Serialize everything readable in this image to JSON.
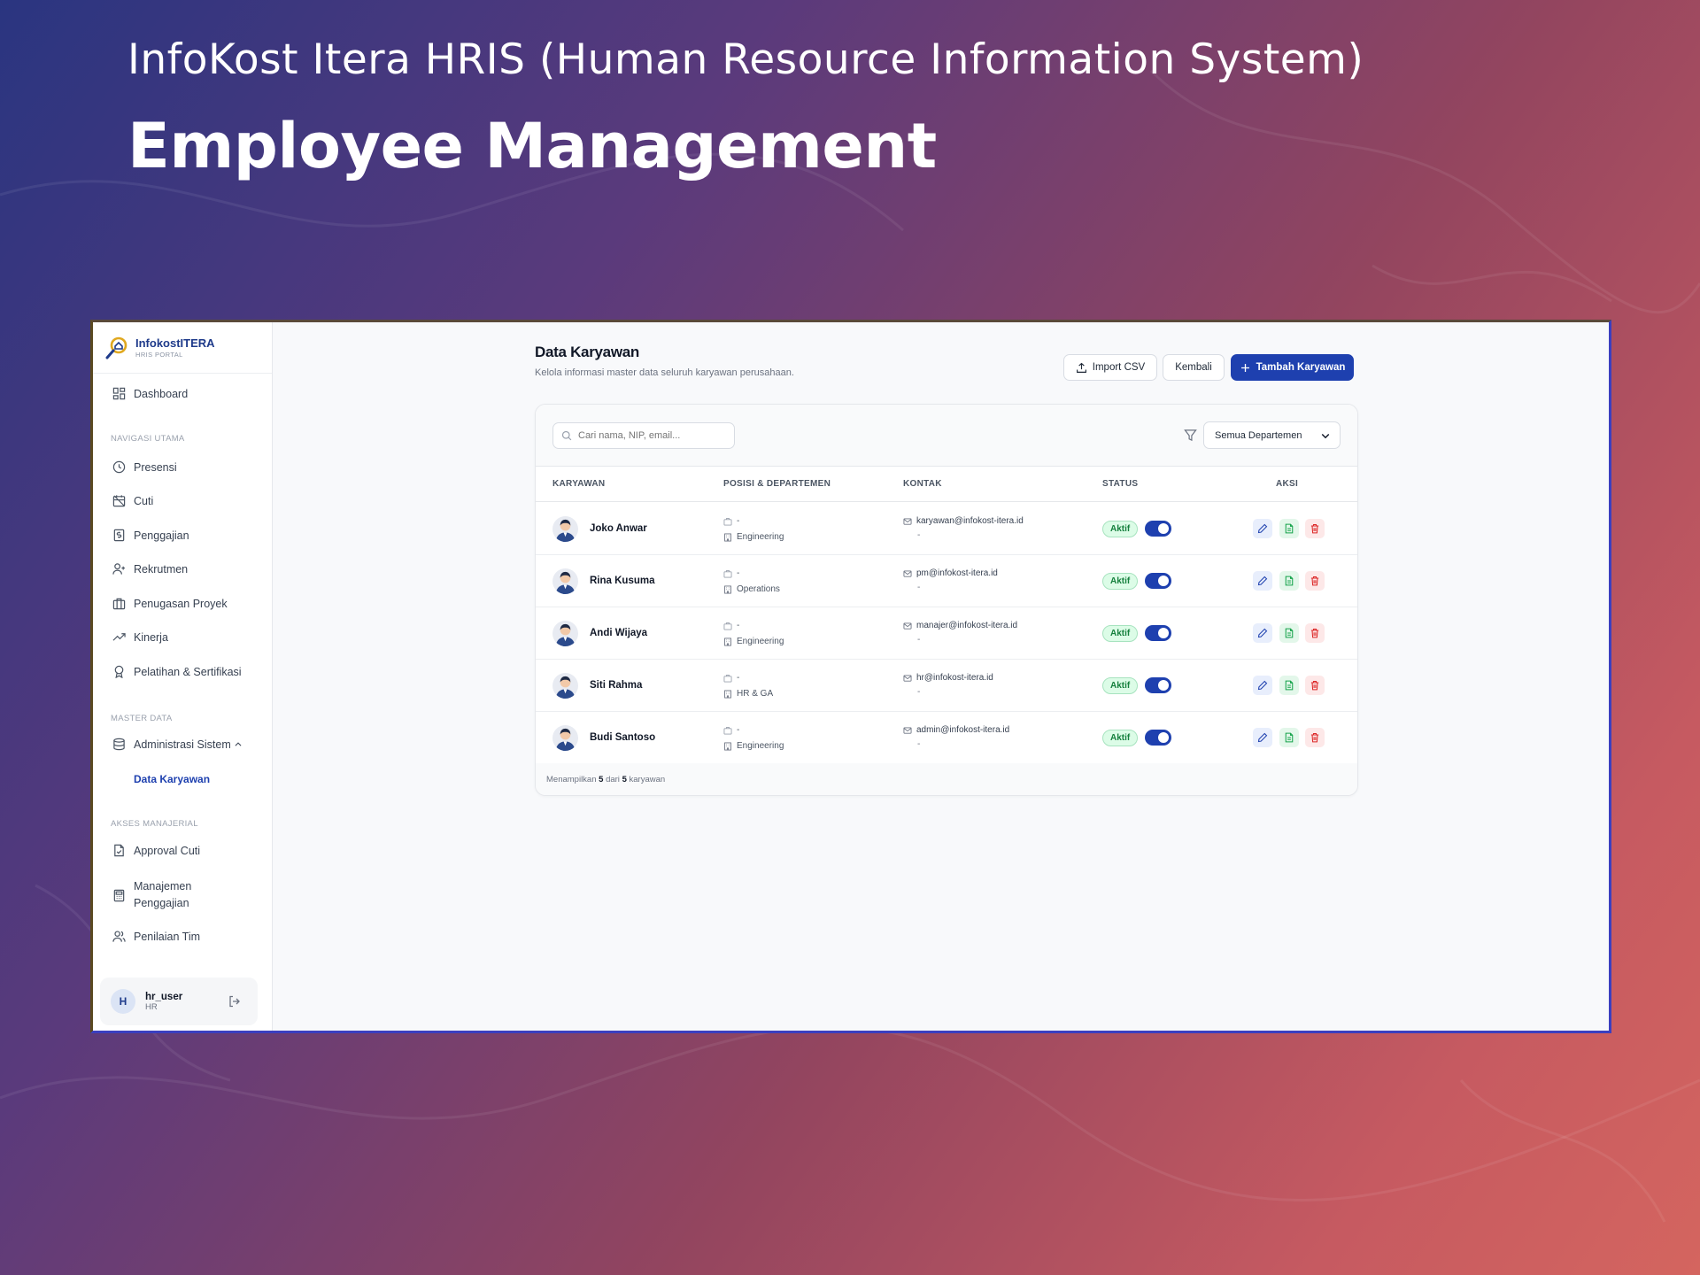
{
  "hero": {
    "subtitle": "InfoKost Itera HRIS (Human Resource Information System)",
    "title": "Employee Management"
  },
  "brand": {
    "name": "InfokostITERA",
    "sub": "HRIS PORTAL"
  },
  "sidebar": {
    "dashboard": "Dashboard",
    "section_main": "NAVIGASI UTAMA",
    "main_items": [
      {
        "label": "Presensi",
        "icon": "clock-icon"
      },
      {
        "label": "Cuti",
        "icon": "calendar-off-icon"
      },
      {
        "label": "Penggajian",
        "icon": "payroll-icon"
      },
      {
        "label": "Rekrutmen",
        "icon": "user-plus-icon"
      },
      {
        "label": "Penugasan Proyek",
        "icon": "briefcase-icon"
      },
      {
        "label": "Kinerja",
        "icon": "trending-up-icon"
      },
      {
        "label": "Pelatihan & Sertifikasi",
        "icon": "award-icon"
      }
    ],
    "section_master": "MASTER DATA",
    "admin": "Administrasi Sistem",
    "admin_sub": "Data Karyawan",
    "section_managerial": "AKSES MANAJERIAL",
    "managerial_items": [
      {
        "label": "Approval Cuti",
        "icon": "file-check-icon"
      },
      {
        "label": "Manajemen",
        "label2": "Penggajian",
        "icon": "calculator-icon"
      },
      {
        "label": "Penilaian Tim",
        "icon": "users-icon"
      }
    ]
  },
  "user": {
    "initial": "H",
    "name": "hr_user",
    "role": "HR"
  },
  "page": {
    "title": "Data Karyawan",
    "description": "Kelola informasi master data seluruh karyawan perusahaan.",
    "import_label": "Import CSV",
    "back_label": "Kembali",
    "add_label": "Tambah Karyawan"
  },
  "toolbar": {
    "search_placeholder": "Cari nama, NIP, email...",
    "department_selected": "Semua Departemen"
  },
  "table": {
    "headers": [
      "KARYAWAN",
      "POSISI & DEPARTEMEN",
      "KONTAK",
      "STATUS",
      "AKSI"
    ],
    "rows": [
      {
        "name": "Joko Anwar",
        "position": "-",
        "department": "Engineering",
        "email": "karyawan@infokost-itera.id",
        "phone": "-",
        "status": "Aktif",
        "active": true
      },
      {
        "name": "Rina Kusuma",
        "position": "-",
        "department": "Operations",
        "email": "pm@infokost-itera.id",
        "phone": "-",
        "status": "Aktif",
        "active": true
      },
      {
        "name": "Andi Wijaya",
        "position": "-",
        "department": "Engineering",
        "email": "manajer@infokost-itera.id",
        "phone": "-",
        "status": "Aktif",
        "active": true
      },
      {
        "name": "Siti Rahma",
        "position": "-",
        "department": "HR & GA",
        "email": "hr@infokost-itera.id",
        "phone": "-",
        "status": "Aktif",
        "active": true
      },
      {
        "name": "Budi Santoso",
        "position": "-",
        "department": "Engineering",
        "email": "admin@infokost-itera.id",
        "phone": "-",
        "status": "Aktif",
        "active": true
      }
    ]
  },
  "footer": {
    "prefix": "Menampilkan",
    "shown": "5",
    "middle": "dari",
    "total": "5",
    "suffix": "karyawan"
  },
  "colors": {
    "primary": "#1e40af",
    "active_badge": "#15803d",
    "delete": "#dc2626"
  }
}
